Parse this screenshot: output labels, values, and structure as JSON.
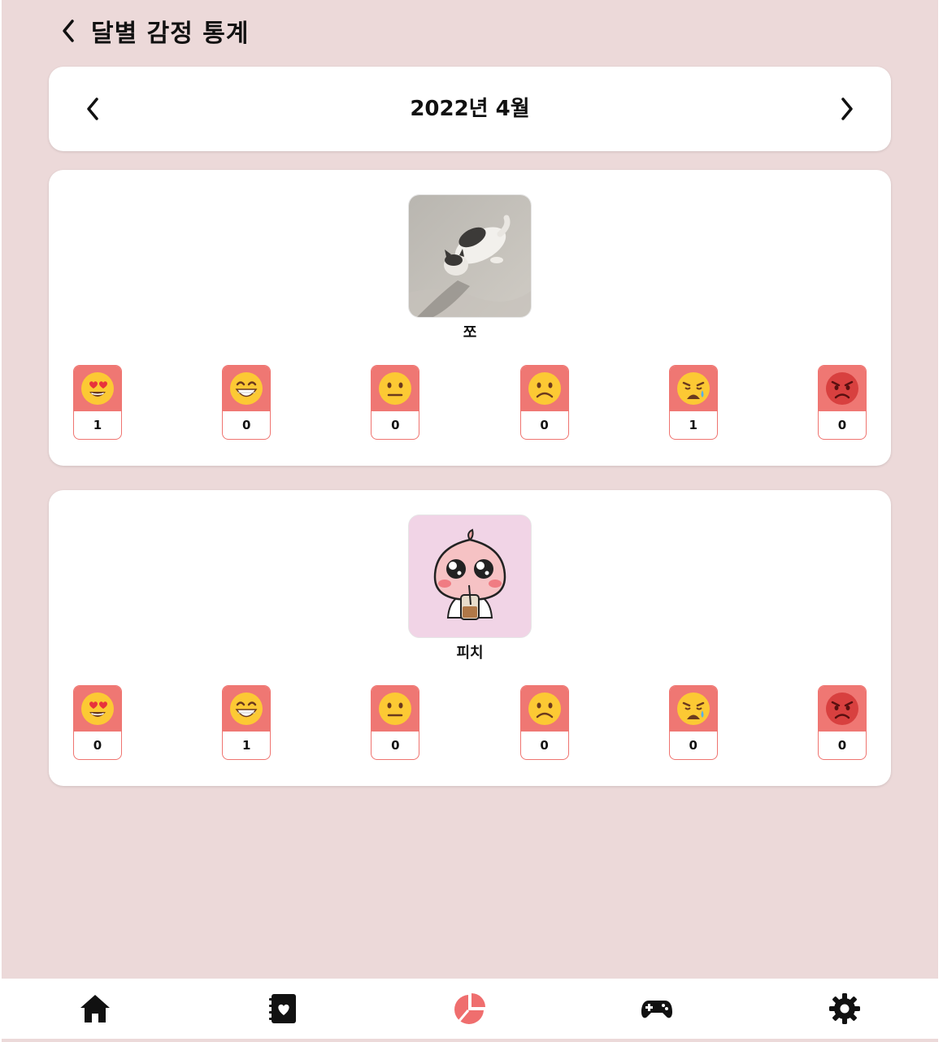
{
  "header": {
    "title": "달별 감정 통계"
  },
  "month_nav": {
    "label": "2022년 4월"
  },
  "pets": [
    {
      "name": "쪼",
      "counts": [
        "1",
        "0",
        "0",
        "0",
        "1",
        "0"
      ]
    },
    {
      "name": "피치",
      "counts": [
        "0",
        "1",
        "0",
        "0",
        "0",
        "0"
      ]
    }
  ],
  "emotions": [
    "heart-eyes-emoji-icon",
    "grinning-emoji-icon",
    "neutral-emoji-icon",
    "sad-emoji-icon",
    "crying-emoji-icon",
    "angry-emoji-icon"
  ],
  "bottom_nav": [
    {
      "icon": "home-icon",
      "active": false
    },
    {
      "icon": "diary-icon",
      "active": false
    },
    {
      "icon": "pie-chart-icon",
      "active": true
    },
    {
      "icon": "gamepad-icon",
      "active": false
    },
    {
      "icon": "settings-gear-icon",
      "active": false
    }
  ],
  "colors": {
    "background": "#ecd9d9",
    "accent": "#ef7773",
    "active_nav": "#ef6e6e"
  }
}
